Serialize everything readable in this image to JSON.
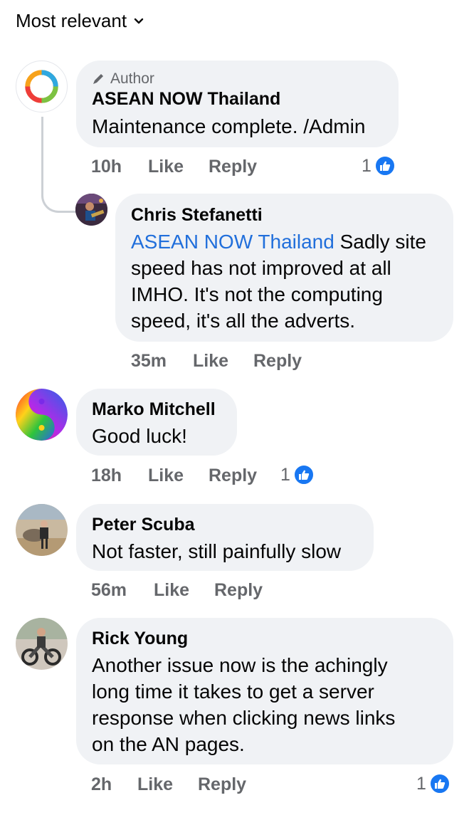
{
  "sort": {
    "label": "Most relevant",
    "icon": "chevron-down-icon"
  },
  "comments": [
    {
      "author_badge": "Author",
      "name": "ASEAN NOW Thailand",
      "text": "Maintenance complete. /Admin",
      "time": "10h",
      "like": "Like",
      "reply": "Reply",
      "reactions": "1",
      "avatar_icon": "asean-now-logo"
    },
    {
      "name": "Chris Stefanetti",
      "mention": "ASEAN NOW Thailand",
      "text_lines": [
        "Sadly site",
        "speed has not improved at all",
        "IMHO. It's not the computing",
        "speed, it's all the adverts."
      ],
      "time": "35m",
      "like": "Like",
      "reply": "Reply",
      "avatar_icon": "guitarist-photo"
    },
    {
      "name": "Marko Mitchell",
      "text": "Good luck!",
      "time": "18h",
      "like": "Like",
      "reply": "Reply",
      "reactions": "1",
      "avatar_icon": "yin-yang-rainbow"
    },
    {
      "name": "Peter Scuba",
      "text": "Not faster, still painfully slow",
      "time": "56m",
      "like": "Like",
      "reply": "Reply",
      "avatar_icon": "beach-horse-photo"
    },
    {
      "name": "Rick Young",
      "text_lines": [
        "Another issue now is the achingly",
        "long time it takes to get a server",
        "response when clicking news links",
        "on the AN pages."
      ],
      "time": "2h",
      "like": "Like",
      "reply": "Reply",
      "reactions": "1",
      "avatar_icon": "motorcycle-photo"
    }
  ],
  "colors": {
    "bubble": "#f0f2f5",
    "link": "#216fdb",
    "meta": "#65676b",
    "like_blue": "#1877f2"
  }
}
